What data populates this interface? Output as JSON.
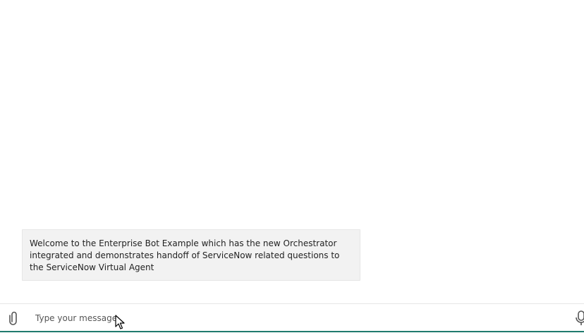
{
  "transcript": {
    "messages": [
      {
        "from": "bot",
        "text": "Welcome to the Enterprise Bot Example which has the new Orchestrator integrated and demonstrates handoff of ServiceNow related questions to the ServiceNow Virtual Agent"
      }
    ]
  },
  "sendbox": {
    "placeholder": "Type your message",
    "attach_icon": "paperclip-icon",
    "mic_icon": "microphone-icon"
  },
  "colors": {
    "bubble_bg": "#f2f2f2",
    "accent": "#1f7a6d"
  }
}
